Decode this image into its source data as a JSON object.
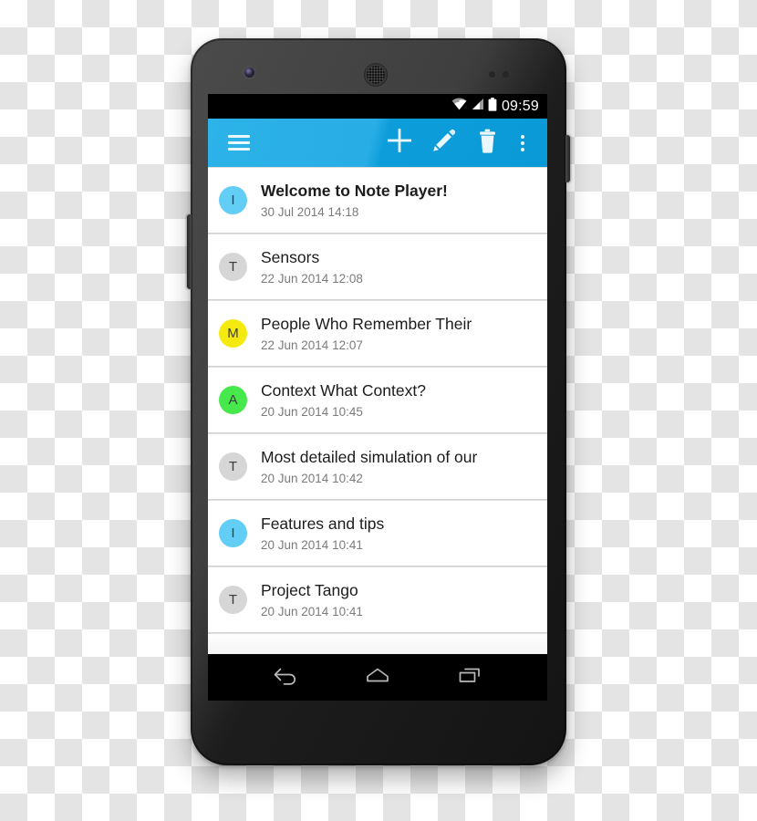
{
  "app": {
    "name": "Note Player",
    "platform": "Android"
  },
  "status_bar": {
    "time": "09:59",
    "icons": [
      "wifi-icon",
      "signal-icon",
      "battery-icon"
    ]
  },
  "action_bar": {
    "accent_color": "#1FA8E0",
    "icon_color": "#EAF7FD",
    "items": [
      {
        "name": "drawer-menu-button",
        "icon": "hamburger-icon",
        "label": "Menu"
      },
      {
        "name": "add-note-button",
        "icon": "plus-icon",
        "label": "Add"
      },
      {
        "name": "edit-note-button",
        "icon": "pencil-icon",
        "label": "Edit"
      },
      {
        "name": "delete-note-button",
        "icon": "trash-icon",
        "label": "Delete"
      },
      {
        "name": "overflow-menu-button",
        "icon": "overflow-dots-icon",
        "label": "More options"
      }
    ]
  },
  "note_list": {
    "notes": [
      {
        "initial": "I",
        "avatar_color": "#62CDF5",
        "title": "Welcome to Note Player!",
        "date": "30 Jul 2014 14:18",
        "unread": true
      },
      {
        "initial": "T",
        "avatar_color": "#D6D6D6",
        "title": "Sensors",
        "date": "22 Jun 2014 12:08",
        "unread": false
      },
      {
        "initial": "M",
        "avatar_color": "#F5EA10",
        "title": "People Who Remember Their",
        "date": "22 Jun 2014 12:07",
        "unread": false
      },
      {
        "initial": "A",
        "avatar_color": "#46E84B",
        "title": "Context What Context?",
        "date": "20 Jun 2014 10:45",
        "unread": false
      },
      {
        "initial": "T",
        "avatar_color": "#D6D6D6",
        "title": "Most detailed simulation of our",
        "date": "20 Jun 2014 10:42",
        "unread": false
      },
      {
        "initial": "I",
        "avatar_color": "#62CDF5",
        "title": "Features and tips",
        "date": "20 Jun 2014 10:41",
        "unread": false
      },
      {
        "initial": "T",
        "avatar_color": "#D6D6D6",
        "title": "Project Tango",
        "date": "20 Jun 2014 10:41",
        "unread": false
      }
    ]
  },
  "nav_bar": {
    "buttons": [
      {
        "name": "back-button",
        "icon": "back-arrow-icon",
        "label": "Back"
      },
      {
        "name": "home-button",
        "icon": "home-icon",
        "label": "Home"
      },
      {
        "name": "recents-button",
        "icon": "recents-icon",
        "label": "Recent apps"
      }
    ]
  }
}
